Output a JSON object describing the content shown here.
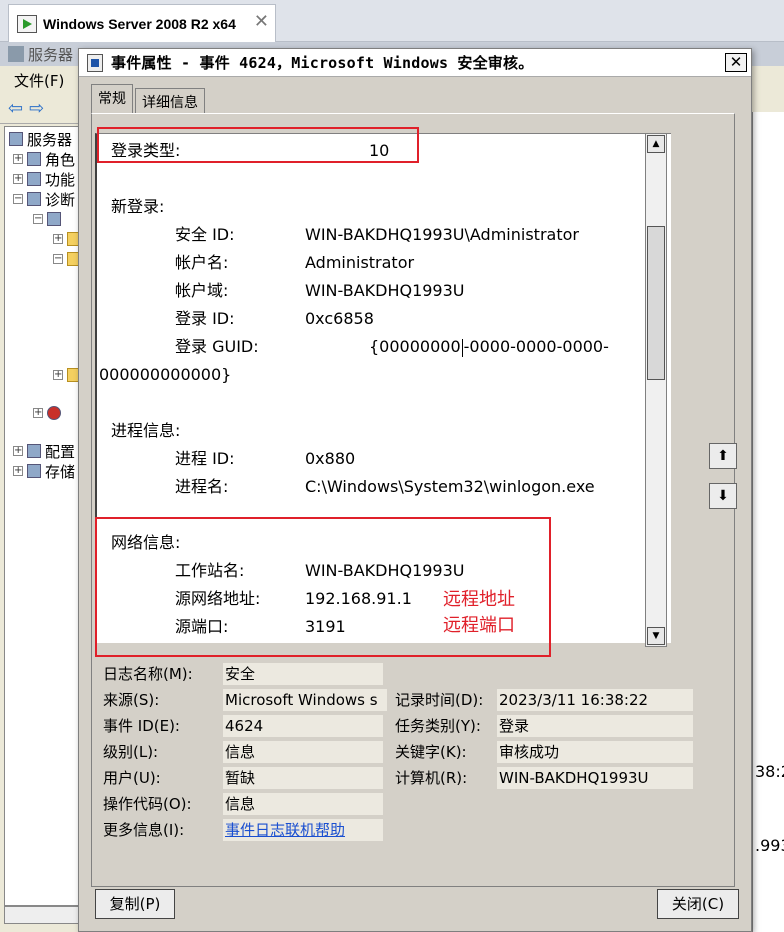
{
  "vm_tab": {
    "title": "Windows Server 2008 R2 x64"
  },
  "server_manager": {
    "title": "服务器",
    "menu_file": "文件(F)",
    "tree": [
      {
        "label": "服务器",
        "level": 0
      },
      {
        "label": "角色",
        "level": 1
      },
      {
        "label": "功能",
        "level": 1
      },
      {
        "label": "诊断",
        "level": 1
      },
      {
        "label": "配置",
        "level": 1
      },
      {
        "label": "存储",
        "level": 1
      }
    ],
    "right_fragments": [
      "38:2",
      ".993"
    ]
  },
  "dialog": {
    "title": "事件属性 - 事件 4624，Microsoft Windows 安全审核。",
    "close_label": "✕",
    "tabs": [
      {
        "label": "常规",
        "active": true
      },
      {
        "label": "详细信息",
        "active": false
      }
    ],
    "description": {
      "logon_type_label": "登录类型:",
      "logon_type_value": "10",
      "new_logon_header": "新登录:",
      "new_logon": [
        {
          "label": "安全 ID:",
          "value": "WIN-BAKDHQ1993U\\Administrator"
        },
        {
          "label": "帐户名:",
          "value": "Administrator"
        },
        {
          "label": "帐户域:",
          "value": "WIN-BAKDHQ1993U"
        },
        {
          "label": "登录 ID:",
          "value": "0xc6858"
        }
      ],
      "logon_guid_label": "登录 GUID:",
      "logon_guid_value_part1": "{00000000",
      "logon_guid_value_part2": "-0000-0000-0000-",
      "logon_guid_value_wrap": "000000000000}",
      "process_header": "进程信息:",
      "process": [
        {
          "label": "进程 ID:",
          "value": "0x880"
        },
        {
          "label": "进程名:",
          "value": "C:\\Windows\\System32\\winlogon.exe"
        }
      ],
      "network_header": "网络信息:",
      "network": [
        {
          "label": "工作站名:",
          "value": "WIN-BAKDHQ1993U"
        },
        {
          "label": "源网络地址:",
          "value": "192.168.91.1"
        },
        {
          "label": "源端口:",
          "value": "3191"
        }
      ]
    },
    "annotations": {
      "remote_address": "远程地址",
      "remote_port": "远程端口",
      "color": "#e0202a"
    },
    "info": {
      "log_name_label": "日志名称(M):",
      "log_name_value": "安全",
      "source_label": "来源(S):",
      "source_value": "Microsoft Windows s",
      "logged_label": "记录时间(D):",
      "logged_value": "2023/3/11 16:38:22",
      "event_id_label": "事件 ID(E):",
      "event_id_value": "4624",
      "task_label": "任务类别(Y):",
      "task_value": "登录",
      "level_label": "级别(L):",
      "level_value": "信息",
      "keywords_label": "关键字(K):",
      "keywords_value": "审核成功",
      "user_label": "用户(U):",
      "user_value": "暂缺",
      "computer_label": "计算机(R):",
      "computer_value": "WIN-BAKDHQ1993U",
      "opcode_label": "操作代码(O):",
      "opcode_value": "信息",
      "more_info_label": "更多信息(I):",
      "more_info_link": "事件日志联机帮助"
    },
    "buttons": {
      "copy": "复制(P)",
      "close": "关闭(C)"
    }
  }
}
